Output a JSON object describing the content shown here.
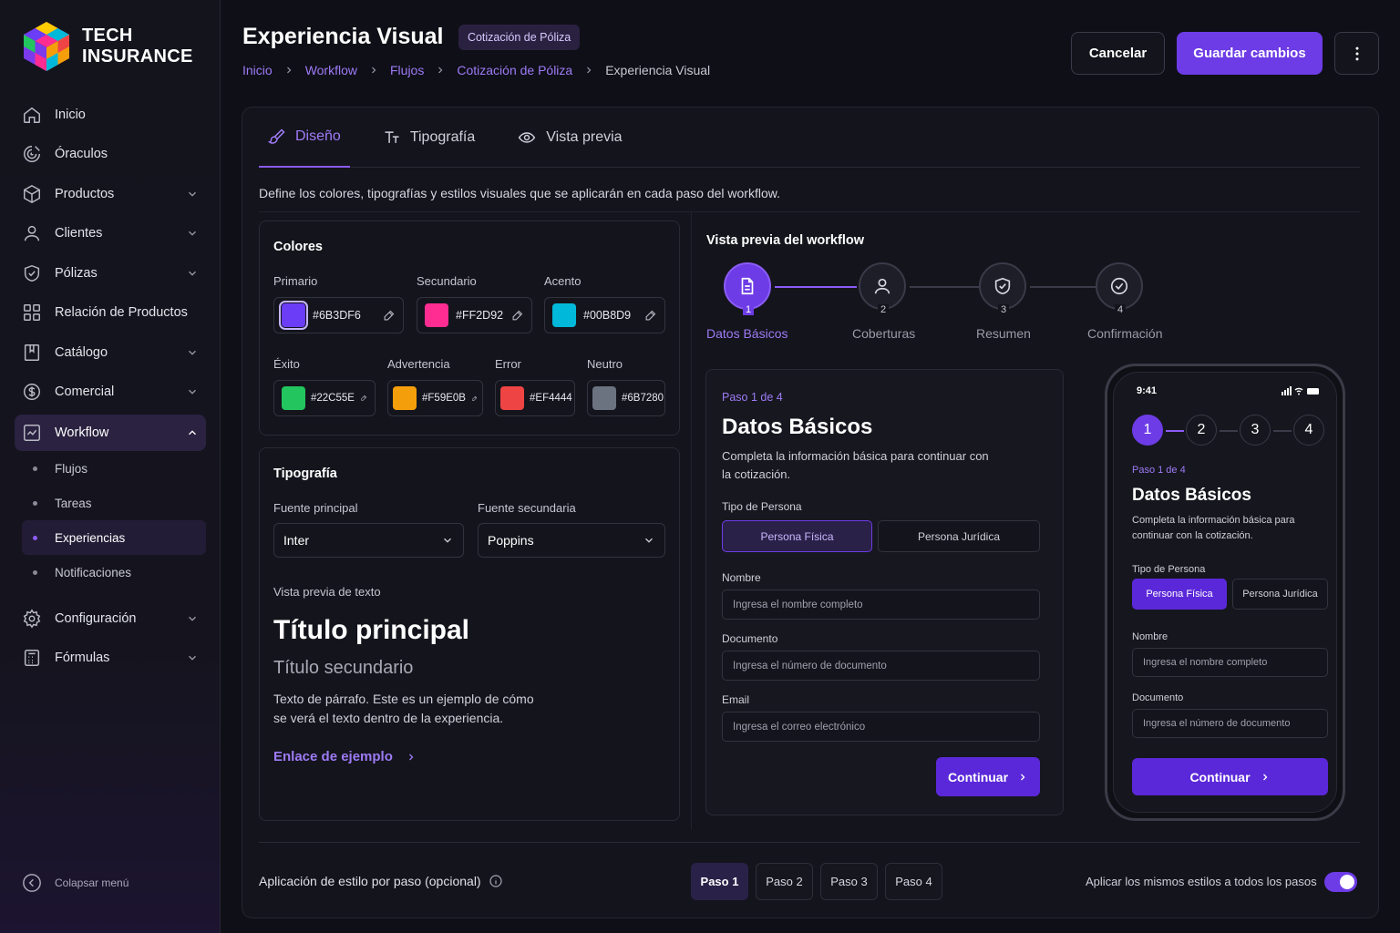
{
  "brand": {
    "line1": "TECH",
    "line2": "INSURANCE"
  },
  "sidebar": {
    "items": [
      {
        "label": "Inicio",
        "icon": "home-icon"
      },
      {
        "label": "Óraculos",
        "icon": "oracle-icon"
      },
      {
        "label": "Productos",
        "icon": "box-icon",
        "expandable": true
      },
      {
        "label": "Clientes",
        "icon": "user-icon",
        "expandable": true
      },
      {
        "label": "Pólizas",
        "icon": "shield-icon",
        "expandable": true
      },
      {
        "label": "Relación de Productos",
        "icon": "grid-icon"
      },
      {
        "label": "Catálogo",
        "icon": "book-icon",
        "expandable": true
      },
      {
        "label": "Comercial",
        "icon": "dollar-icon",
        "expandable": true
      },
      {
        "label": "Workflow",
        "icon": "workflow-icon",
        "expanded": true
      }
    ],
    "workflow_sub": [
      "Flujos",
      "Tareas",
      "Experiencias",
      "Notificaciones"
    ],
    "items_after": [
      {
        "label": "Configuración",
        "icon": "gear-icon"
      },
      {
        "label": "Fórmulas",
        "icon": "calculator-icon"
      }
    ],
    "collapse_label": "Colapsar menú"
  },
  "header": {
    "title": "Experiencia Visual",
    "badge": "Cotización de Póliza",
    "breadcrumb": [
      "Inicio",
      "Workflow",
      "Flujos",
      "Cotización de Póliza",
      "Experiencia Visual"
    ],
    "cancel_label": "Cancelar",
    "save_label": "Guardar cambios"
  },
  "tabs": [
    "Diseño",
    "Tipografía",
    "Vista previa"
  ],
  "description": "Define los colores, tipografías y estilos visuales que se aplicarán en cada paso del workflow.",
  "colors": {
    "title": "Colores",
    "primary": {
      "label": "Primario",
      "hex": "#6B3DF6"
    },
    "secondary": {
      "label": "Secundario",
      "hex": "#FF2D92"
    },
    "accent": {
      "label": "Acento",
      "hex": "#00B8D9"
    },
    "success": {
      "label": "Éxito",
      "hex": "#22C55E"
    },
    "warning": {
      "label": "Advertencia",
      "hex": "#F59E0B"
    },
    "error": {
      "label": "Error",
      "hex": "#EF4444"
    },
    "neutral": {
      "label": "Neutro",
      "hex": "#6B7280"
    }
  },
  "typography": {
    "title": "Tipografía",
    "primary_font_label": "Fuente principal",
    "primary_font": "Inter",
    "secondary_font_label": "Fuente secundaria",
    "secondary_font": "Poppins",
    "preview_label": "Vista previa de texto",
    "h1": "Título principal",
    "h2": "Título secundario",
    "paragraph": "Texto de párrafo. Este es un ejemplo de cómo se verá el texto dentro de la experiencia.",
    "link": "Enlace de ejemplo"
  },
  "preview": {
    "title": "Vista previa del workflow",
    "steps": [
      {
        "n": "1",
        "label": "Datos Básicos"
      },
      {
        "n": "2",
        "label": "Coberturas"
      },
      {
        "n": "3",
        "label": "Resumen"
      },
      {
        "n": "4",
        "label": "Confirmación"
      }
    ],
    "form": {
      "step_of": "Paso 1 de 4",
      "title": "Datos Básicos",
      "desc": "Completa la información básica para continuar con la cotización.",
      "person_type_label": "Tipo de Persona",
      "person_natural": "Persona Física",
      "person_legal": "Persona Jurídica",
      "name_label": "Nombre",
      "name_placeholder": "Ingresa el nombre completo",
      "doc_label": "Documento",
      "doc_placeholder": "Ingresa el número de documento",
      "email_label": "Email",
      "email_placeholder": "Ingresa el correo electrónico",
      "continue": "Continuar"
    },
    "phone": {
      "time": "9:41"
    }
  },
  "bottom": {
    "label": "Aplicación de estilo por paso (opcional)",
    "steps": [
      "Paso 1",
      "Paso 2",
      "Paso 3",
      "Paso 4"
    ],
    "apply_all_label": "Aplicar los mismos estilos a todos los pasos",
    "apply_all": true
  }
}
